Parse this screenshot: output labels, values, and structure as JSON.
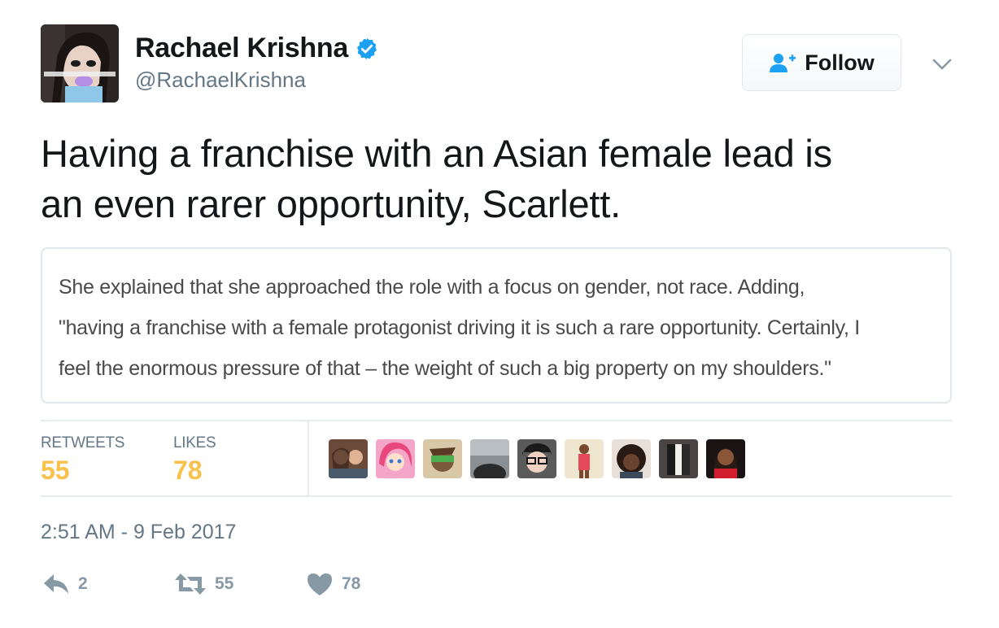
{
  "author": {
    "display_name": "Rachael Krishna",
    "handle": "@RachaelKrishna",
    "verified": true
  },
  "follow_button": {
    "label": "Follow"
  },
  "tweet": {
    "text_line1": "Having a franchise with an Asian female lead is",
    "text_line2": "an even rarer opportunity, Scarlett."
  },
  "quote": {
    "line1": "She explained that she approached the role with a focus on gender, not race. Adding,",
    "line2": "\"having a franchise with a female protagonist driving it is such a rare opportunity. Certainly, I",
    "line3": "feel the enormous pressure of that – the weight of such a big property on my shoulders.\""
  },
  "stats": {
    "retweets_label": "RETWEETS",
    "retweets_value": "55",
    "likes_label": "LIKES",
    "likes_value": "78"
  },
  "timestamp": "2:51 AM - 9 Feb 2017",
  "actions": {
    "reply_count": "2",
    "retweet_count": "55",
    "like_count": "78"
  },
  "colors": {
    "stat_value": "#f7c14b",
    "verified": "#1da1f2",
    "follow_icon": "#1da1f2",
    "action_icon": "#8899a6"
  }
}
